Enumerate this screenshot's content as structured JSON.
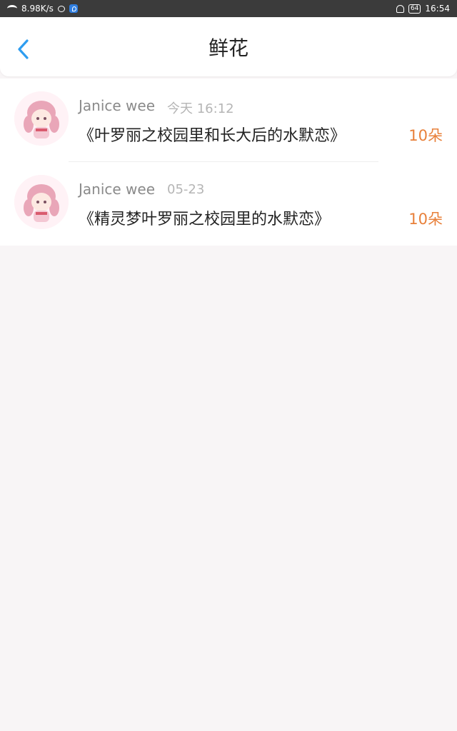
{
  "status_bar": {
    "net_speed": "8.98K/s",
    "battery": "64",
    "time": "16:54"
  },
  "header": {
    "title": "鲜花"
  },
  "items": [
    {
      "user": "Janice wee",
      "time": "今天 16:12",
      "book": "《叶罗丽之校园里和长大后的水默恋》",
      "count": "10朵"
    },
    {
      "user": "Janice wee",
      "time": "05-23",
      "book": "《精灵梦叶罗丽之校园里的水默恋》",
      "count": "10朵"
    }
  ],
  "colors": {
    "accent": "#2e9df0",
    "count": "#e8803a"
  }
}
